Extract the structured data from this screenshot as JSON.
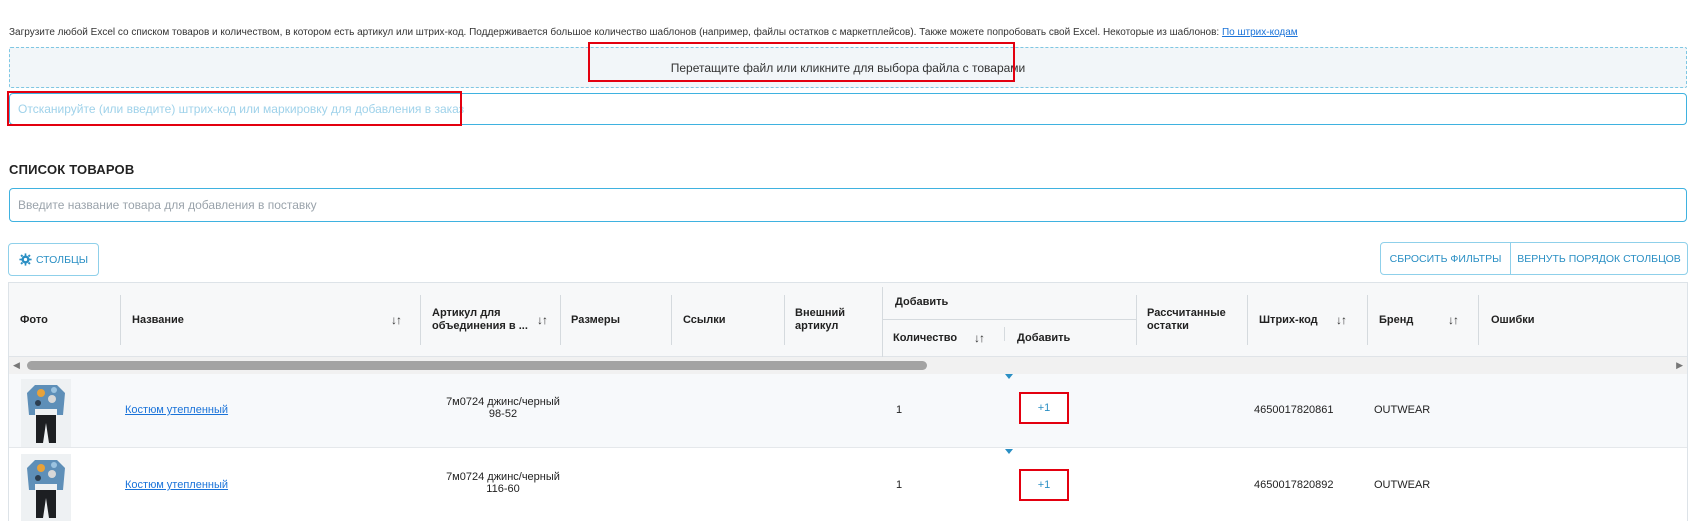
{
  "intro": {
    "text": "Загрузите любой Excel со списком товаров и количеством, в котором есть артикул или штрих-код. Поддерживается большое количество шаблонов (например, файлы остатков с маркетплейсов). Также можете попробовать свой Excel. Некоторые из шаблонов:",
    "link": "По штрих-кодам"
  },
  "dropzone": {
    "label": "Перетащите файл или кликните для выбора файла с товарами"
  },
  "scan_input": {
    "placeholder": "Отсканируйте (или введите) штрих-код или маркировку для добавления в заказ"
  },
  "list": {
    "title": "СПИСОК ТОВАРОВ",
    "search_placeholder": "Введите название товара для добавления в поставку"
  },
  "toolbar": {
    "columns_label": "СТОЛБЦЫ",
    "reset_filters_label": "СБРОСИТЬ ФИЛЬТРЫ",
    "restore_order_label": "ВЕРНУТЬ ПОРЯДОК СТОЛБЦОВ"
  },
  "table": {
    "headers": {
      "photo": "Фото",
      "name": "Название",
      "article": "Артикул для объединения в ...",
      "sizes": "Размеры",
      "links": "Ссылки",
      "external_article": "Внешний артикул",
      "add_group": "Добавить",
      "quantity": "Количество",
      "add": "Добавить",
      "calc_stock": "Рассчитанные остатки",
      "barcode": "Штрих-код",
      "brand": "Бренд",
      "errors": "Ошибки"
    },
    "sort_icon": "↓↑",
    "rows": [
      {
        "name": "Костюм утепленный",
        "article_line1": "7м0724 джинс/черный",
        "article_line2": "98-52",
        "quantity": "1",
        "add_button": "+1",
        "barcode": "4650017820861",
        "brand": "OUTWEAR"
      },
      {
        "name": "Костюм утепленный",
        "article_line1": "7м0724 джинс/черный",
        "article_line2": "116-60",
        "quantity": "1",
        "add_button": "+1",
        "barcode": "4650017820892",
        "brand": "OUTWEAR"
      }
    ]
  },
  "colors": {
    "accent": "#2a8fc4",
    "border": "#3fb2e0",
    "highlight": "#e3000f",
    "link": "#1a73d9"
  }
}
